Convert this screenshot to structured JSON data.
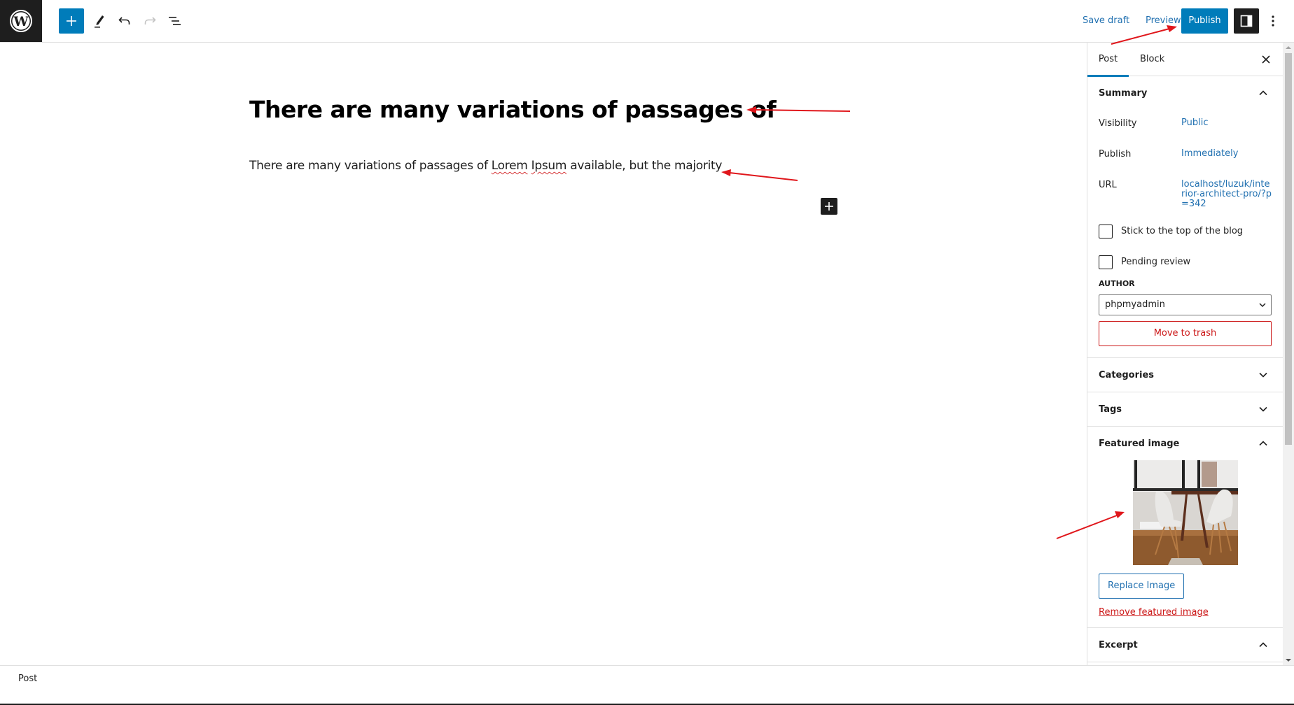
{
  "toolbar": {
    "logo_icon": "wordpress-logo-icon",
    "inserter_icon": "plus-icon",
    "tools_icon": "pencil-icon",
    "undo_icon": "undo-icon",
    "redo_icon": "redo-icon",
    "list_view_icon": "list-view-icon",
    "save_draft_label": "Save draft",
    "preview_label": "Preview",
    "publish_label": "Publish",
    "settings_icon": "sidebar-toggle-icon",
    "more_icon": "vertical-ellipsis-icon"
  },
  "editor": {
    "title": "There are many variations of passages of",
    "paragraph": {
      "before": "There are many variations of passages of ",
      "misspelled_1": "Lorem",
      "space": " ",
      "misspelled_2": "Ipsum",
      "after": " available, but the majority"
    },
    "appender_icon": "plus-icon"
  },
  "sidebar": {
    "tabs": [
      {
        "label": "Post",
        "active": true
      },
      {
        "label": "Block",
        "active": false
      }
    ],
    "close_icon": "close-icon",
    "summary": {
      "title": "Summary",
      "expanded": true,
      "rows": [
        {
          "label": "Visibility",
          "value": "Public"
        },
        {
          "label": "Publish",
          "value": "Immediately"
        },
        {
          "label": "URL",
          "value": "localhost/luzuk/interior-architect-pro/?p=342"
        }
      ],
      "sticky_label": "Stick to the top of the blog",
      "sticky_checked": false,
      "pending_label": "Pending review",
      "pending_checked": false,
      "author_label": "Author",
      "author_value": "phpmyadmin",
      "trash_label": "Move to trash"
    },
    "categories": {
      "title": "Categories",
      "expanded": false
    },
    "tags": {
      "title": "Tags",
      "expanded": false
    },
    "featured_image": {
      "title": "Featured image",
      "expanded": true,
      "image_alt": "Dining table with white chairs",
      "replace_label": "Replace Image",
      "remove_label": "Remove featured image"
    },
    "excerpt": {
      "title": "Excerpt",
      "expanded": true
    }
  },
  "footer": {
    "breadcrumb": "Post"
  },
  "colors": {
    "accent": "#007cba",
    "link": "#2271b1",
    "danger": "#cc1818",
    "dark": "#1e1e1e",
    "annotation": "#e0161b"
  }
}
